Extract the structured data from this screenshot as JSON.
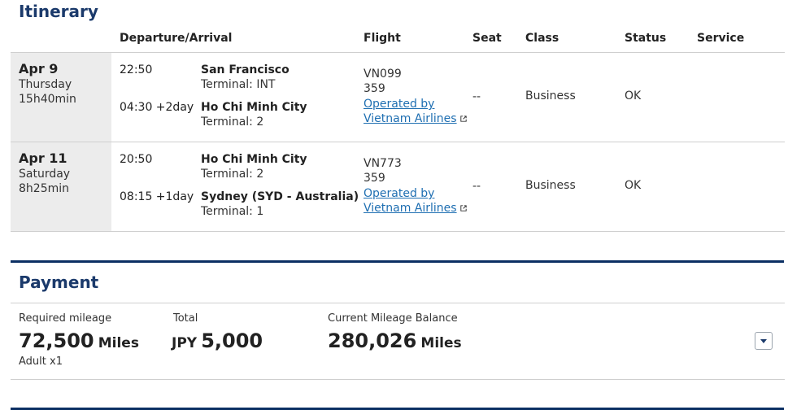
{
  "itinerary": {
    "title": "Itinerary",
    "columns": {
      "departure_arrival": "Departure/Arrival",
      "flight": "Flight",
      "seat": "Seat",
      "class": "Class",
      "status": "Status",
      "service": "Service"
    },
    "segments": [
      {
        "date": "Apr 9",
        "weekday": "Thursday",
        "duration": "15h40min",
        "dep_time": "22:50",
        "dep_city": "San Francisco",
        "dep_terminal": "Terminal: INT",
        "arr_time": "04:30 +2day",
        "arr_city": "Ho Chi Minh City",
        "arr_terminal": "Terminal: 2",
        "flight_no": "VN099",
        "aircraft": "359",
        "operator": "Operated by Vietnam Airlines",
        "seat": "--",
        "class": "Business",
        "status": "OK"
      },
      {
        "date": "Apr 11",
        "weekday": "Saturday",
        "duration": "8h25min",
        "dep_time": "20:50",
        "dep_city": "Ho Chi Minh City",
        "dep_terminal": "Terminal: 2",
        "arr_time": "08:15 +1day",
        "arr_city": "Sydney (SYD - Australia)",
        "arr_terminal": "Terminal: 1",
        "flight_no": "VN773",
        "aircraft": "359",
        "operator": "Operated by Vietnam Airlines",
        "seat": "--",
        "class": "Business",
        "status": "OK"
      }
    ]
  },
  "payment": {
    "title": "Payment",
    "required_label": "Required mileage",
    "required_value": "72,500",
    "required_unit": "Miles",
    "passengers": "Adult x1",
    "total_label": "Total",
    "total_currency": "JPY",
    "total_value": "5,000",
    "balance_label": "Current Mileage Balance",
    "balance_value": "280,026",
    "balance_unit": "Miles"
  },
  "icons": {
    "external_link": "external-link-icon",
    "dropdown": "chevron-down-icon"
  },
  "colors": {
    "heading": "#1b3a6b",
    "link": "#1f6fb2",
    "divider_thick": "#0b2f63"
  }
}
